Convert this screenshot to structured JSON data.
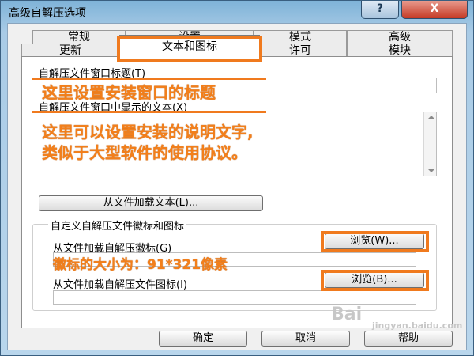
{
  "window": {
    "title": "高级自解压选项",
    "help_glyph": "?",
    "close_glyph": "X"
  },
  "tabs": {
    "row1": [
      "常规",
      "设置",
      "模式",
      "高级"
    ],
    "row2": [
      "更新",
      "文本和图标",
      "许可",
      "模块"
    ],
    "active": "文本和图标"
  },
  "panel": {
    "title_label": "自解压文件窗口标题(T)",
    "title_value": "",
    "text_label": "自解压文件窗口中显示的文本(X)",
    "text_value": "",
    "load_text_button": "从文件加载文本(L)...",
    "group_label": "自定义自解压文件徽标和图标",
    "logo_label": "从文件加载自解压徽标(G)",
    "logo_browse": "浏览(W)...",
    "logo_value": "",
    "icon_label": "从文件加载自解压文件图标(I)",
    "icon_browse": "浏览(B)...",
    "icon_value": ""
  },
  "annotations": {
    "title_note": "这里设置安装窗口的标题",
    "text_note_line1": "这里可以设置安装的说明文字,",
    "text_note_line2": "类似于大型软件的使用协议。",
    "logo_note": "徽标的大小为：91*321像素"
  },
  "buttons": {
    "ok": "确定",
    "cancel": "取消",
    "help": "帮助"
  },
  "watermark": {
    "brand": "Bai",
    "site": "jingyan.baidu.com"
  },
  "colors": {
    "annotation": "#f37f1a",
    "titlebar": "#a9cbe6",
    "close": "#c53a25"
  }
}
